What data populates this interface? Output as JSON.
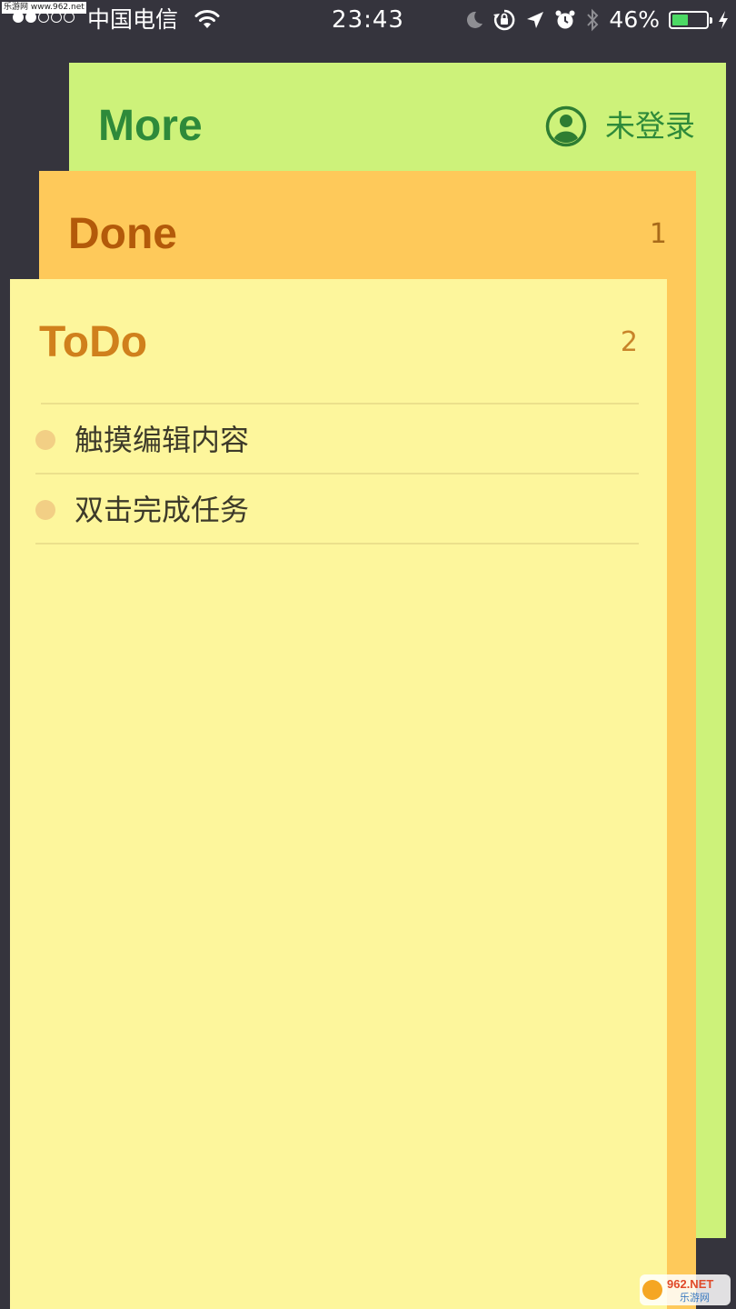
{
  "status_bar": {
    "watermark": "乐游网 www.962.net",
    "signal_dots_filled": 2,
    "signal_dots_total": 5,
    "carrier": "中国电信",
    "time": "23:43",
    "battery_percent": "46%",
    "battery_level": 0.46,
    "icons": [
      "wifi-icon",
      "moon-icon",
      "rotation-lock-icon",
      "location-arrow-icon",
      "alarm-icon",
      "bluetooth-icon",
      "battery-icon",
      "charging-bolt-icon"
    ]
  },
  "cards": {
    "more": {
      "title": "More",
      "account_label": "未登录",
      "account_icon": "user-circle-icon",
      "color": "#cdf27a",
      "title_color": "#2e8a3a"
    },
    "done": {
      "title": "Done",
      "count": "1",
      "color": "#fec95a",
      "title_color": "#b35a0a"
    },
    "todo": {
      "title": "ToDo",
      "count": "2",
      "color": "#fdf69c",
      "title_color": "#d0801c",
      "items": [
        {
          "text": "触摸编辑内容"
        },
        {
          "text": "双击完成任务"
        }
      ]
    }
  },
  "watermark_bottom": {
    "line1": "962.NET",
    "line2": "乐游网"
  }
}
